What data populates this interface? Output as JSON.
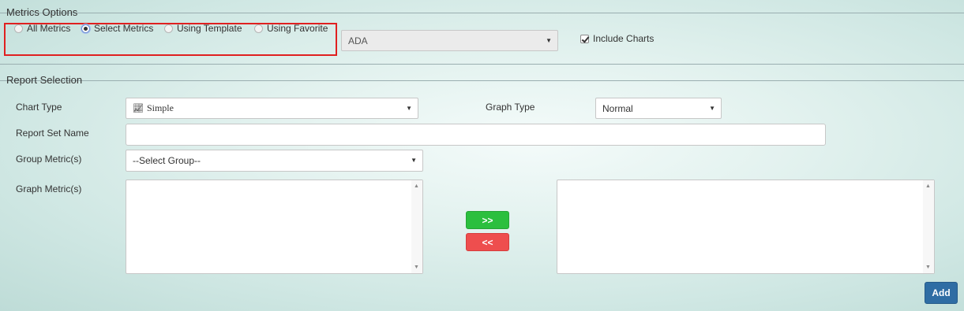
{
  "metrics_options": {
    "legend": "Metrics Options",
    "radios": [
      {
        "label": "All Metrics",
        "checked": false
      },
      {
        "label": "Select Metrics",
        "checked": true
      },
      {
        "label": "Using Template",
        "checked": false
      },
      {
        "label": "Using Favorite",
        "checked": false
      }
    ],
    "metric_select": {
      "value": "ADA",
      "disabled": true
    },
    "include_charts": {
      "label": "Include Charts",
      "checked": true
    }
  },
  "report_selection": {
    "legend": "Report Selection",
    "chart_type": {
      "label": "Chart Type",
      "value": "Simple",
      "icon": "line-chart-icon"
    },
    "graph_type": {
      "label": "Graph Type",
      "value": "Normal"
    },
    "report_set_name": {
      "label": "Report Set Name",
      "value": ""
    },
    "group_metrics": {
      "label": "Group Metric(s)",
      "value": "--Select Group--"
    },
    "graph_metrics": {
      "label": "Graph Metric(s)"
    },
    "move_right_label": ">>",
    "move_left_label": "<<",
    "add_label": "Add"
  },
  "colors": {
    "highlight": "#e02020",
    "move_right": "#2bbf3e",
    "move_left": "#ee4e4e",
    "add": "#2f6da4"
  }
}
